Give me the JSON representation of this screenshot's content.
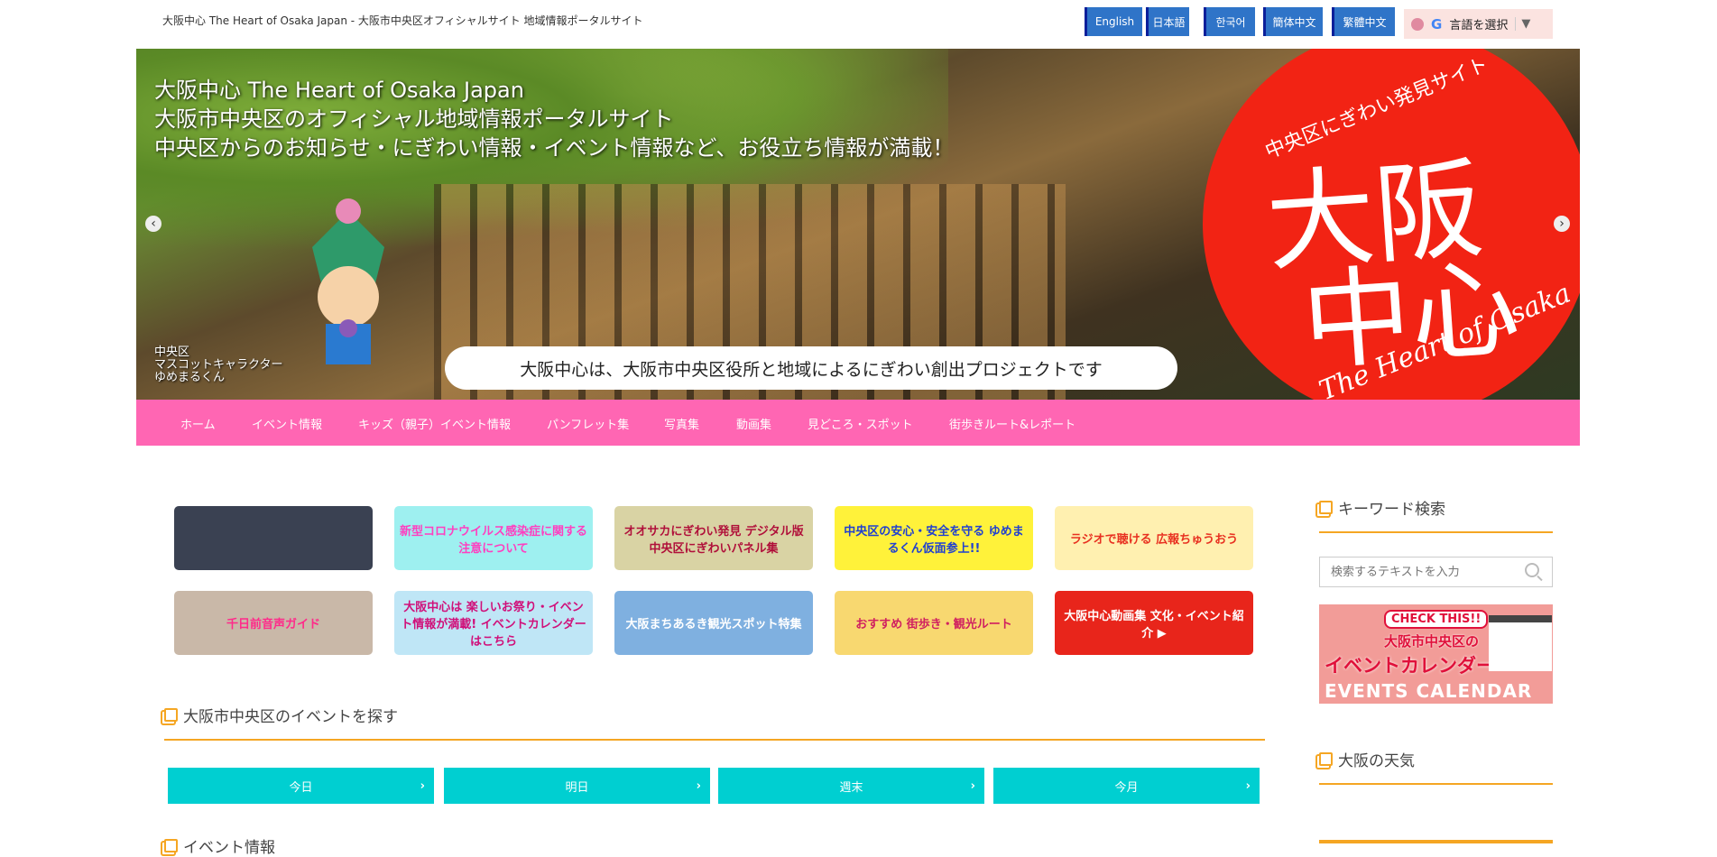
{
  "header": {
    "tagline": "大阪中心 The Heart of Osaka Japan - 大阪市中央区オフィシャルサイト 地域情報ポータルサイト",
    "languages": [
      "English",
      "日本語",
      "한국어",
      "簡体中文",
      "繁體中文"
    ],
    "translate": {
      "g": "G",
      "label": "言語を選択",
      "arrow": "▼"
    }
  },
  "hero": {
    "lines": [
      "大阪中心 The Heart of Osaka Japan",
      "大阪市中央区のオフィシャル地域情報ポータルサイト",
      "中央区からのお知らせ・にぎわい情報・イベント情報など、お役立ち情報が満載！"
    ],
    "logo_sub": "中央区にぎわい発見サイト",
    "logo_big1": "大阪",
    "logo_big2": "中心",
    "logo_eng": "The Heart of Osaka",
    "caption": "大阪中心は、大阪市中央区役所と地域によるにぎわい創出プロジェクトです",
    "mascot_label": [
      "中央区",
      "マスコットキャラクター",
      "ゆめまるくん"
    ],
    "prev": "‹",
    "next": "›"
  },
  "nav": [
    "ホーム",
    "イベント情報",
    "キッズ（親子）イベント情報",
    "パンフレット集",
    "写真集",
    "動画集",
    "見どころ・スポット",
    "街歩きルート&レポート"
  ],
  "tiles": [
    {
      "text": "",
      "bg": "#3a4152",
      "color": "#fff"
    },
    {
      "text": "新型コロナウイルス感染症に関する注意について",
      "bg": "#9ef0f0",
      "color": "#ff3fc0"
    },
    {
      "text": "オオサカにぎわい発見 デジタル版 中央区にぎわいパネル集",
      "bg": "#d9d3a4",
      "color": "#b0103a"
    },
    {
      "text": "中央区の安心・安全を守る ゆめまるくん仮面参上!!",
      "bg": "#fff23a",
      "color": "#2040d0"
    },
    {
      "text": "ラジオで聴ける 広報ちゅうおう",
      "bg": "#fff0b0",
      "color": "#e83020"
    },
    {
      "text": "千日前音声ガイド",
      "bg": "#c9b8a8",
      "color": "#ff2a8a"
    },
    {
      "text": "大阪中心は 楽しいお祭り・イベント情報が満載! イベントカレンダーはこちら",
      "bg": "#bfe6f6",
      "color": "#d0107a"
    },
    {
      "text": "大阪まちあるき観光スポット特集",
      "bg": "#7fb0e0",
      "color": "#fff"
    },
    {
      "text": "おすすめ 街歩き・観光ルート",
      "bg": "#f8d870",
      "color": "#d02060"
    },
    {
      "text": "大阪中心動画集 文化・イベント紹介 ▶",
      "bg": "#e8251b",
      "color": "#fff"
    }
  ],
  "events": {
    "title": "大阪市中央区のイベントを探す",
    "buttons": [
      "今日",
      "明日",
      "週末",
      "今月"
    ],
    "chev": "›",
    "next_title": "イベント情報"
  },
  "sidebar": {
    "search_title": "キーワード検索",
    "search_placeholder": "検索するテキストを入力",
    "calendar": {
      "check": "CHECK THIS!!",
      "title1": "大阪市中央区の",
      "title2": "イベントカレンダー",
      "en": "EVENTS CALENDAR"
    },
    "weather_title": "大阪の天気"
  },
  "colors": {
    "nav": "#ff66b3",
    "accent": "#f5a623",
    "event_button": "#00cfd1",
    "lang_button": "#2f74c8"
  }
}
